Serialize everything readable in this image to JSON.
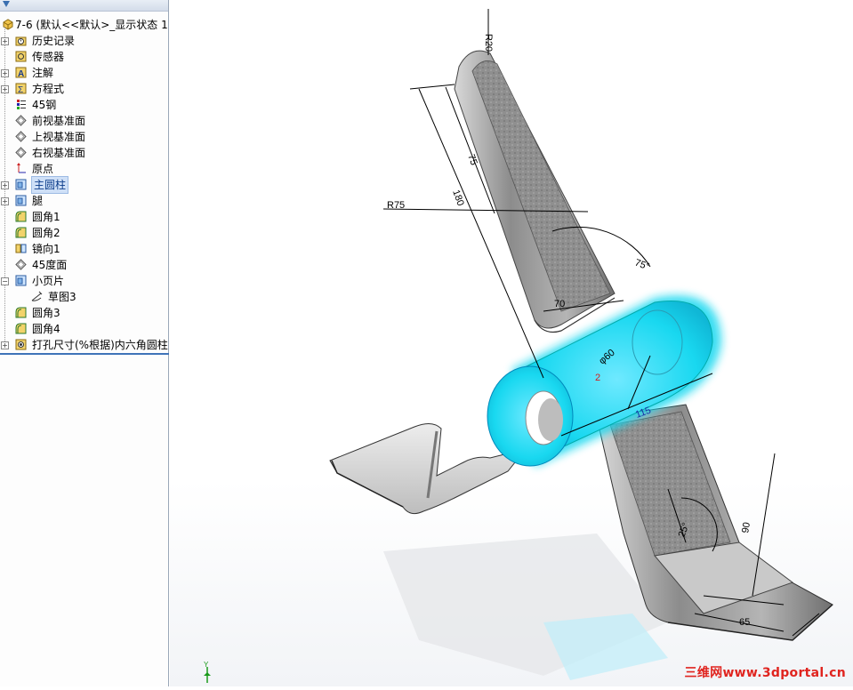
{
  "feature_tree": {
    "root_label": "7-6  (默认<<默认>_显示状态 1",
    "items": [
      {
        "label": "历史记录",
        "icon": "history-folder-icon",
        "expandable": true
      },
      {
        "label": "传感器",
        "icon": "sensor-icon",
        "expandable": false
      },
      {
        "label": "注解",
        "icon": "annotation-icon",
        "expandable": true
      },
      {
        "label": "方程式",
        "icon": "equation-icon",
        "expandable": true
      },
      {
        "label": "45钢",
        "icon": "material-icon",
        "expandable": false
      },
      {
        "label": "前视基准面",
        "icon": "plane-icon",
        "expandable": false
      },
      {
        "label": "上视基准面",
        "icon": "plane-icon",
        "expandable": false
      },
      {
        "label": "右视基准面",
        "icon": "plane-icon",
        "expandable": false
      },
      {
        "label": "原点",
        "icon": "origin-icon",
        "expandable": false
      },
      {
        "label": "主圆柱",
        "icon": "extrude-icon",
        "expandable": true,
        "selected": true
      },
      {
        "label": "腿",
        "icon": "extrude-icon",
        "expandable": true
      },
      {
        "label": "圆角1",
        "icon": "fillet-icon",
        "expandable": false
      },
      {
        "label": "圆角2",
        "icon": "fillet-icon",
        "expandable": false
      },
      {
        "label": "镜向1",
        "icon": "mirror-icon",
        "expandable": false
      },
      {
        "label": "45度面",
        "icon": "plane-icon",
        "expandable": false
      },
      {
        "label": "小页片",
        "icon": "extrude-icon",
        "expandable": true,
        "expanded": true
      },
      {
        "label": "草图3",
        "icon": "sketch-icon",
        "expandable": false,
        "child": true
      },
      {
        "label": "圆角3",
        "icon": "fillet-icon",
        "expandable": false
      },
      {
        "label": "圆角4",
        "icon": "fillet-icon",
        "expandable": false
      },
      {
        "label": "打孔尺寸(%根据)内六角圆柱",
        "icon": "hole-wizard-icon",
        "expandable": true
      }
    ]
  },
  "dimensions": {
    "r20": "R20",
    "d75a": "75",
    "d180": "180",
    "r75": "R75",
    "ang75": "75°",
    "d70": "70",
    "dia": "φ60",
    "d2": "2",
    "d115": "115",
    "ang25": "25°",
    "d90": "90",
    "d65": "65"
  },
  "watermark": "三维网www.3dportal.cn",
  "colors": {
    "highlight": "#19d8f0",
    "part_metal": "#9a9a9a",
    "dimension_line": "#000000",
    "selected_row": "#cfe0f7"
  }
}
